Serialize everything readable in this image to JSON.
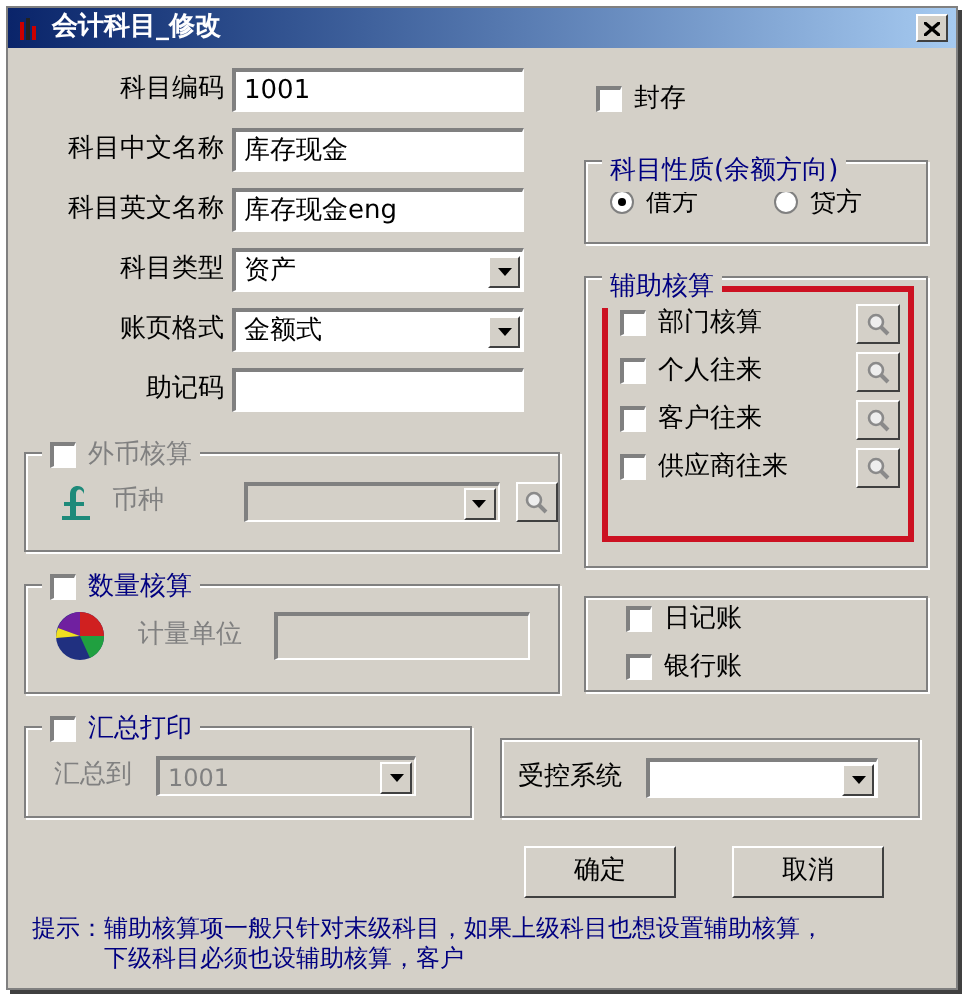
{
  "window": {
    "title": "会计科目_修改"
  },
  "fields": [
    {
      "label": "科目编码",
      "value": "1001",
      "kind": "text"
    },
    {
      "label": "科目中文名称",
      "value": "库存现金",
      "kind": "text"
    },
    {
      "label": "科目英文名称",
      "value": "库存现金eng",
      "kind": "text"
    },
    {
      "label": "科目类型",
      "value": "资产",
      "kind": "select"
    },
    {
      "label": "账页格式",
      "value": "金额式",
      "kind": "select"
    },
    {
      "label": "助记码",
      "kind": "text"
    }
  ],
  "sealed": {
    "label": "封存",
    "checked": false
  },
  "nature": {
    "title": "科目性质(余额方向)",
    "options": [
      {
        "label": "借方",
        "selected": true
      },
      {
        "label": "贷方",
        "selected": false
      }
    ]
  },
  "auxiliary": {
    "title": "辅助核算",
    "highlighted": true,
    "items": [
      {
        "label": "部门核算",
        "checked": false
      },
      {
        "label": "个人往来",
        "checked": false
      },
      {
        "label": "客户往来",
        "checked": false
      },
      {
        "label": "供应商往来",
        "checked": false
      }
    ]
  },
  "foreign_currency": {
    "label": "外币核算",
    "checked": false,
    "disabled": true,
    "field_label": "币种"
  },
  "quantity": {
    "label": "数量核算",
    "checked": false,
    "field_label": "计量单位"
  },
  "books": [
    {
      "label": "日记账",
      "checked": false
    },
    {
      "label": "银行账",
      "checked": false
    }
  ],
  "summary_print": {
    "label": "汇总打印",
    "checked": false,
    "field_label": "汇总到",
    "value": "1001"
  },
  "controlled_system": {
    "label": "受控系统"
  },
  "buttons": [
    "确定",
    "取消"
  ],
  "hint": {
    "label": "提示：",
    "lines": [
      "辅助核算项一般只针对末级科目，如果上级科目也想设置辅助核算，",
      "下级科目必须也设辅助核算，客户"
    ]
  }
}
